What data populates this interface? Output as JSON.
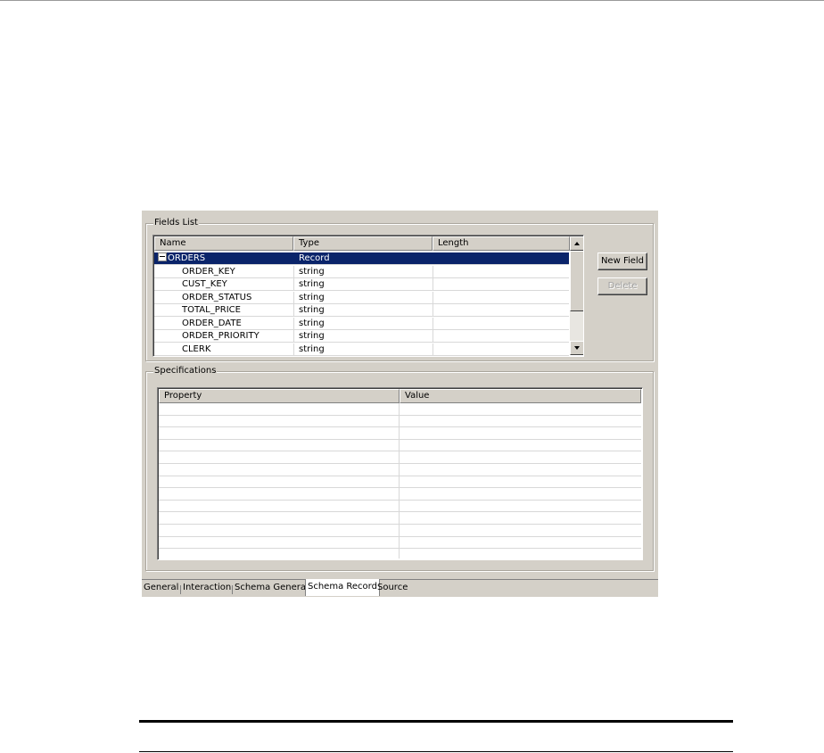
{
  "fields_list": {
    "title": "Fields List",
    "columns": [
      "Name",
      "Type",
      "Length"
    ],
    "rows": [
      {
        "name": "ORDERS",
        "type": "Record",
        "length": "",
        "expanded": true,
        "selected": true
      },
      {
        "name": "ORDER_KEY",
        "type": "string",
        "length": ""
      },
      {
        "name": "CUST_KEY",
        "type": "string",
        "length": ""
      },
      {
        "name": "ORDER_STATUS",
        "type": "string",
        "length": ""
      },
      {
        "name": "TOTAL_PRICE",
        "type": "string",
        "length": ""
      },
      {
        "name": "ORDER_DATE",
        "type": "string",
        "length": ""
      },
      {
        "name": "ORDER_PRIORITY",
        "type": "string",
        "length": ""
      },
      {
        "name": "CLERK",
        "type": "string",
        "length": ""
      }
    ],
    "buttons": {
      "new_field": "New Field",
      "delete": "Delete"
    }
  },
  "specifications": {
    "title": "Specifications",
    "columns": [
      "Property",
      "Value"
    ]
  },
  "tabs": [
    {
      "label": "General",
      "active": false
    },
    {
      "label": "Interaction",
      "active": false
    },
    {
      "label": "Schema General",
      "active": false
    },
    {
      "label": "Schema Record",
      "active": true
    },
    {
      "label": "Source",
      "active": false
    }
  ],
  "colors": {
    "selection": "#0a246a",
    "panel": "#d4d0c8"
  }
}
